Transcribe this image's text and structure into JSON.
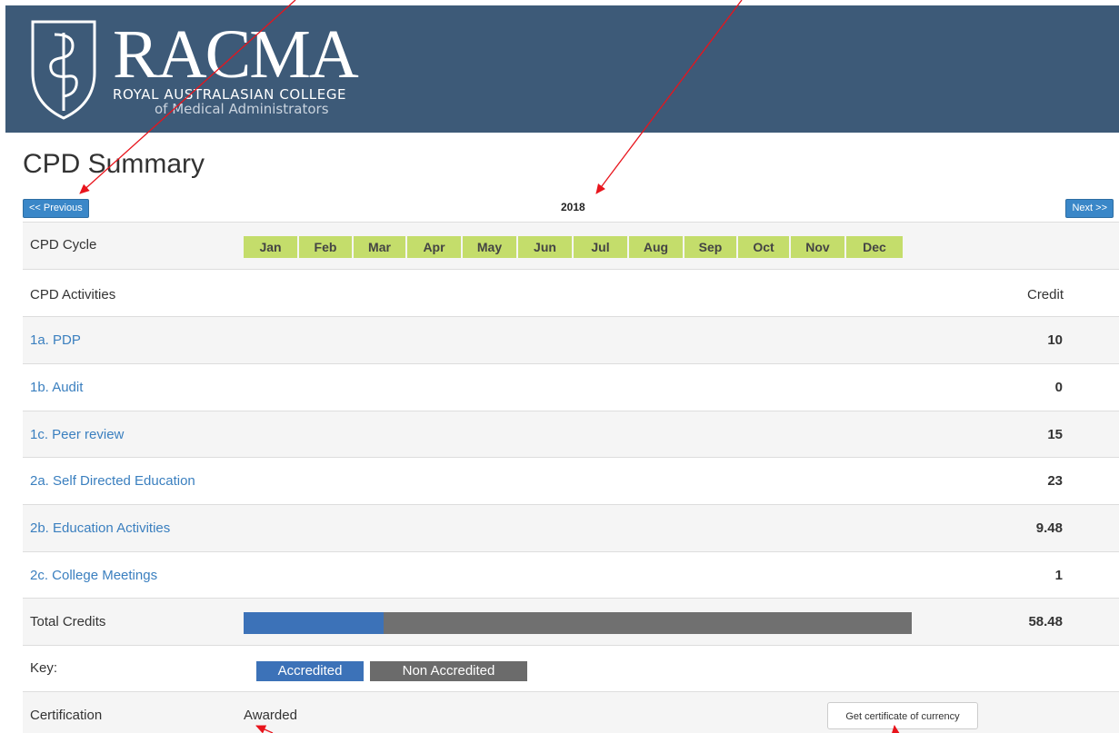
{
  "header": {
    "logo_text": "RACMA",
    "logo_subtitle_line1": "ROYAL AUSTRALASIAN COLLEGE",
    "logo_subtitle_line2": "of Medical Administrators"
  },
  "page": {
    "title": "CPD Summary",
    "year": "2018",
    "prev_label": "<< Previous",
    "next_label": "Next >>"
  },
  "cycle": {
    "label": "CPD Cycle",
    "months": [
      "Jan",
      "Feb",
      "Mar",
      "Apr",
      "May",
      "Jun",
      "Jul",
      "Aug",
      "Sep",
      "Oct",
      "Nov",
      "Dec"
    ]
  },
  "activities_header": {
    "label": "CPD Activities",
    "credit_label": "Credit"
  },
  "activities": [
    {
      "label": "1a. PDP",
      "credit": "10"
    },
    {
      "label": "1b. Audit",
      "credit": "0"
    },
    {
      "label": "1c. Peer review",
      "credit": "15"
    },
    {
      "label": "2a. Self Directed Education",
      "credit": "23"
    },
    {
      "label": "2b. Education Activities",
      "credit": "9.48"
    },
    {
      "label": "2c. College Meetings",
      "credit": "1"
    }
  ],
  "total": {
    "label": "Total Credits",
    "value": "58.48",
    "accredited_fraction": 0.21
  },
  "key": {
    "label": "Key:",
    "accredited": "Accredited",
    "non_accredited": "Non Accredited"
  },
  "certification": {
    "label": "Certification",
    "status": "Awarded",
    "button_label": "Get certificate of currency"
  },
  "colors": {
    "header_bg": "#3d5a78",
    "month_bg": "#c4dd6b",
    "accredited": "#3c72b8",
    "non_accredited": "#6b6b6b",
    "link": "#3a7fbf",
    "arrow": "#e8141c"
  }
}
